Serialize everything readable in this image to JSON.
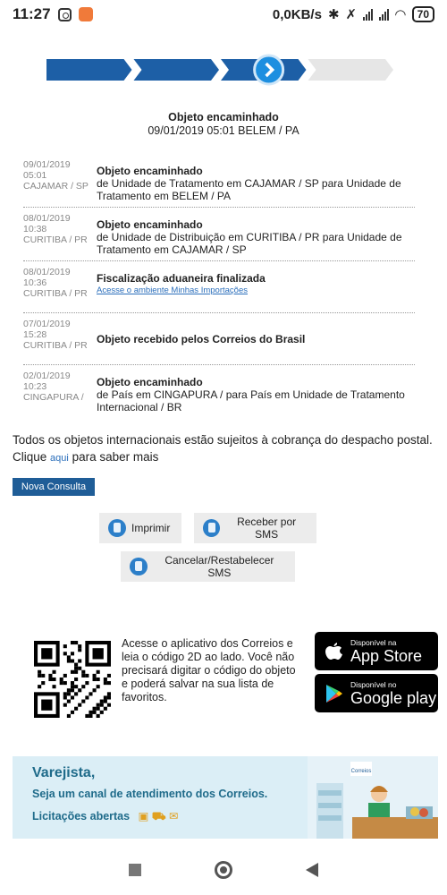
{
  "status_bar": {
    "time": "11:27",
    "speed": "0,0KB/s",
    "battery": "70"
  },
  "progress": {
    "steps_total": 4,
    "steps_completed": 3,
    "active_color": "#1d5fa6",
    "inactive_color": "#e6e6e6"
  },
  "current": {
    "title": "Objeto encaminhado",
    "subtitle": "09/01/2019 05:01 BELEM / PA"
  },
  "history": [
    {
      "date": "09/01/2019",
      "time": "05:01",
      "place": "CAJAMAR / SP",
      "event": "Objeto encaminhado",
      "detail": "de Unidade de Tratamento em CAJAMAR / SP para Unidade de Tratamento em BELEM / PA",
      "link": ""
    },
    {
      "date": "08/01/2019",
      "time": "10:38",
      "place": "CURITIBA / PR",
      "event": "Objeto encaminhado",
      "detail": "de Unidade de Distribuição em CURITIBA / PR para Unidade de Tratamento em CAJAMAR / SP",
      "link": ""
    },
    {
      "date": "08/01/2019",
      "time": "10:36",
      "place": "CURITIBA / PR",
      "event": "Fiscalização aduaneira finalizada",
      "detail": "",
      "link": "Acesse o ambiente Minhas Importações"
    },
    {
      "date": "07/01/2019",
      "time": "15:28",
      "place": "CURITIBA / PR",
      "event": "Objeto recebido pelos Correios do Brasil",
      "detail": "",
      "link": ""
    },
    {
      "date": "02/01/2019",
      "time": "10:23",
      "place": "CINGAPURA /",
      "event": "Objeto encaminhado",
      "detail": "de País em CINGAPURA / para País em Unidade de Tratamento Internacional / BR",
      "link": ""
    }
  ],
  "note": {
    "text": "Todos os objetos internacionais estão sujeitos à cobrança do despacho postal.",
    "click": "Clique",
    "link": "aqui",
    "after": "para saber mais"
  },
  "buttons": {
    "nova_consulta": "Nova Consulta",
    "imprimir": "Imprimir",
    "receber_sms": "Receber por SMS",
    "cancelar_sms": "Cancelar/Restabelecer SMS"
  },
  "promo": {
    "text": "Acesse o aplicativo dos Correios e leia o código 2D ao lado. Você não precisará digitar o código do objeto e poderá salvar na sua lista de favoritos.",
    "apple_small": "Disponível na",
    "apple_big": "App Store",
    "google_small": "Disponível no",
    "google_big": "Google play"
  },
  "banner": {
    "line1": "Varejista,",
    "line2": "Seja um canal de atendimento dos Correios.",
    "line3": "Licitações abertas",
    "brand": "Correios"
  }
}
